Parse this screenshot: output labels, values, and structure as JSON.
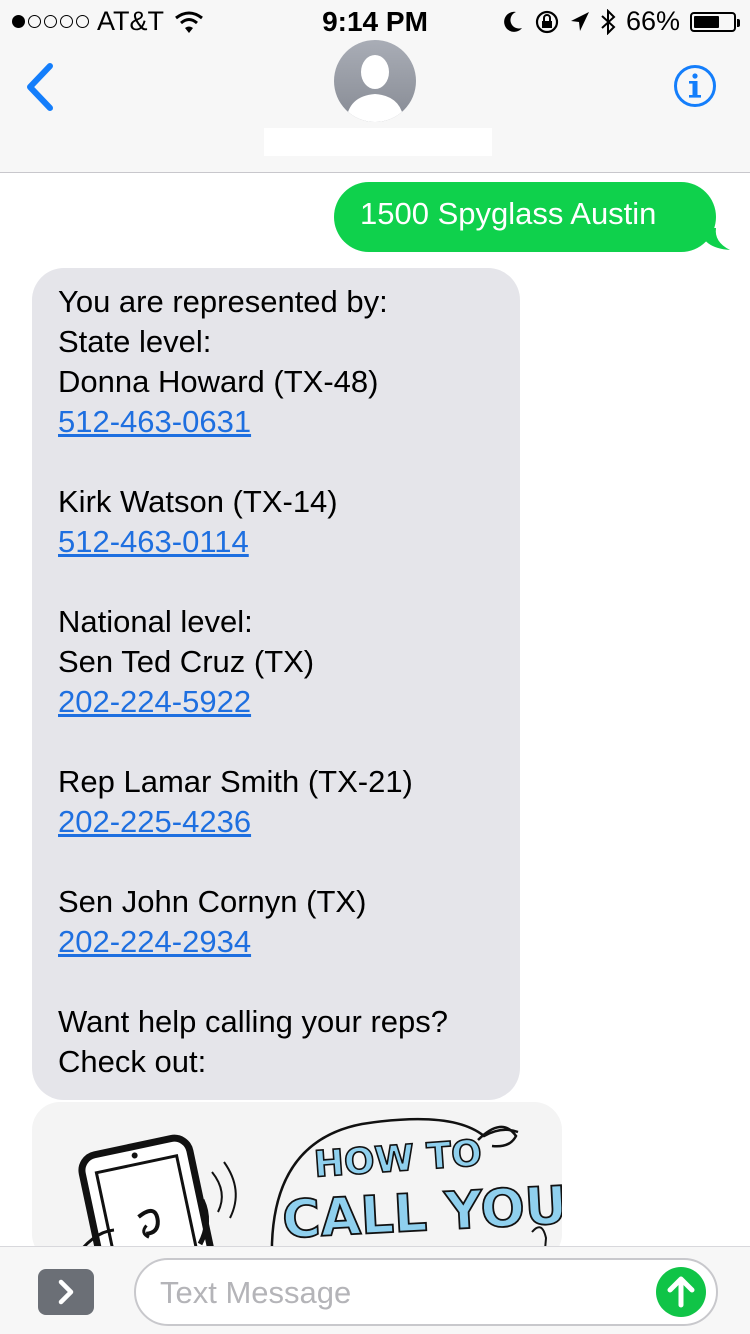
{
  "status_bar": {
    "carrier": "AT&T",
    "signal_bars": 1,
    "time": "9:14 PM",
    "battery": "66%",
    "battery_level": 0.66
  },
  "nav": {
    "back_icon": "chevron-left-icon",
    "avatar_icon": "person-silhouette-icon",
    "info_icon": "info-icon"
  },
  "messages": {
    "sent": "1500 Spyglass Austin",
    "received": {
      "intro": "You are represented by:",
      "state_header": "State level:",
      "state_reps": [
        {
          "name": "Donna Howard (TX-48)",
          "phone": "512-463-0631"
        },
        {
          "name": "Kirk Watson (TX-14)",
          "phone": "512-463-0114"
        }
      ],
      "national_header": "National level:",
      "national_reps": [
        {
          "name": "Sen Ted Cruz (TX)",
          "phone": "202-224-5922"
        },
        {
          "name": "Rep Lamar Smith (TX-21)",
          "phone": "202-225-4236"
        },
        {
          "name": "Sen John Cornyn (TX)",
          "phone": "202-224-2934"
        }
      ],
      "outro_1": "Want help calling your reps?",
      "outro_2": "Check out:"
    },
    "preview": {
      "line1": "HOW TO",
      "line2": "CALL YOUR"
    }
  },
  "input": {
    "placeholder": "Text Message",
    "apps_icon": "chevron-right-icon",
    "send_icon": "arrow-up-icon"
  },
  "colors": {
    "sent_bubble": "#0fd14c",
    "received_bubble": "#e5e5ea",
    "link": "#1e6fe0",
    "accent": "#147efb"
  }
}
